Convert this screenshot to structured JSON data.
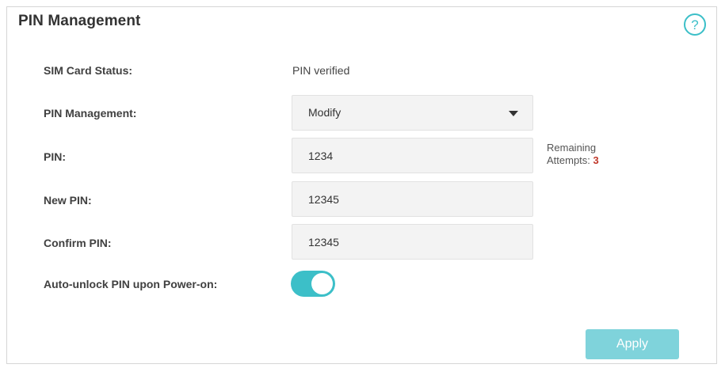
{
  "panel": {
    "title": "PIN Management",
    "help_icon": "help-question-icon"
  },
  "sim_status": {
    "label": "SIM Card Status:",
    "value": "PIN verified"
  },
  "pin_management": {
    "label": "PIN Management:",
    "selected": "Modify"
  },
  "pin": {
    "label": "PIN:",
    "value": "1234",
    "remaining_label_line1": "Remaining",
    "remaining_label_line2": "Attempts:",
    "remaining_count": "3"
  },
  "new_pin": {
    "label": "New PIN:",
    "value": "12345"
  },
  "confirm_pin": {
    "label": "Confirm PIN:",
    "value": "12345"
  },
  "auto_unlock": {
    "label": "Auto-unlock PIN upon Power-on:",
    "enabled": true
  },
  "actions": {
    "apply_label": "Apply"
  },
  "colors": {
    "accent": "#3cbfc8",
    "apply_button": "#7fd3db",
    "remaining_count": "#c0392b"
  }
}
